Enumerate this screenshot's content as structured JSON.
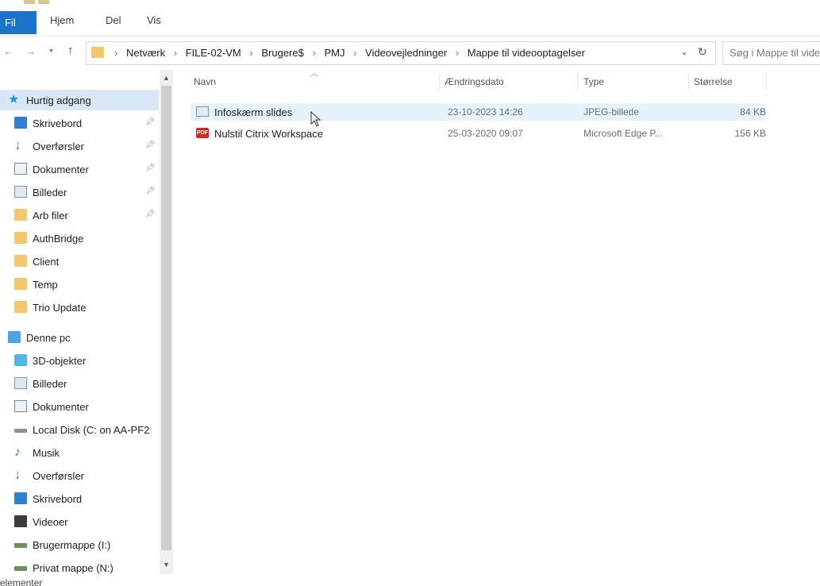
{
  "ribbon": {
    "tabs": [
      "Fil",
      "Hjem",
      "Del",
      "Vis"
    ]
  },
  "address": {
    "crumbs": [
      "Netværk",
      "FILE-02-VM",
      "Brugere$",
      "PMJ",
      "Videovejledninger",
      "Mappe til videooptagelser"
    ],
    "search_placeholder": "Søg i Mappe til videooptagelser"
  },
  "sidebar": {
    "quick_access": "Hurtig adgang",
    "pinned": [
      {
        "label": "Skrivebord",
        "icon": "desktop-icon"
      },
      {
        "label": "Overførsler",
        "icon": "download-icon"
      },
      {
        "label": "Dokumenter",
        "icon": "documents-icon"
      },
      {
        "label": "Billeder",
        "icon": "pictures-icon"
      },
      {
        "label": "Arb filer",
        "icon": "folder-icon"
      }
    ],
    "recent": [
      "AuthBridge",
      "Client",
      "Temp",
      "Trio Update"
    ],
    "this_pc": "Denne pc",
    "pc_items": [
      {
        "label": "3D-objekter",
        "icon": "3d-objects-icon"
      },
      {
        "label": "Billeder",
        "icon": "pictures-icon"
      },
      {
        "label": "Dokumenter",
        "icon": "documents-icon"
      },
      {
        "label": "Local Disk (C: on AA-PF2",
        "icon": "drive-icon"
      },
      {
        "label": "Musik",
        "icon": "music-icon"
      },
      {
        "label": "Overførsler",
        "icon": "download-icon"
      },
      {
        "label": "Skrivebord",
        "icon": "desktop-icon"
      },
      {
        "label": "Videoer",
        "icon": "videos-icon"
      },
      {
        "label": "Brugermappe (I:)",
        "icon": "network-drive-icon"
      },
      {
        "label": "Privat mappe (N:)",
        "icon": "network-drive-icon"
      }
    ]
  },
  "list": {
    "columns": {
      "name": "Navn",
      "date": "Ændringsdato",
      "type": "Type",
      "size": "Størrelse"
    },
    "files": [
      {
        "name": "Infoskærm slides",
        "date": "23-10-2023 14:26",
        "type": "JPEG-billede",
        "size": "84 KB",
        "icon": "jpeg-file-icon"
      },
      {
        "name": "Nulstil Citrix Workspace",
        "date": "25-03-2020 09:07",
        "type": "Microsoft Edge P...",
        "size": "156 KB",
        "icon": "pdf-file-icon"
      }
    ]
  },
  "status": {
    "text": "elementer"
  },
  "colors": {
    "accent": "#1a73c9",
    "selection": "#e5f3ff",
    "folder": "#f3c86a"
  }
}
